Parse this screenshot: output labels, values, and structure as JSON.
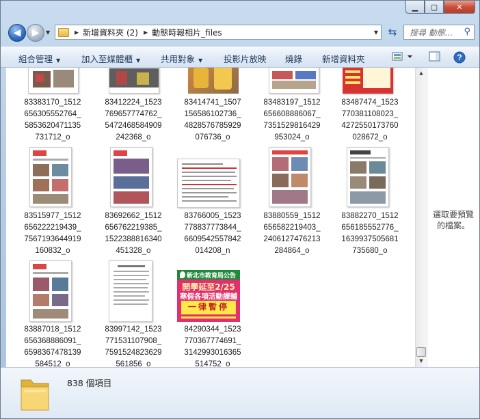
{
  "nav": {
    "breadcrumb": [
      "新增資料夾 (2)",
      "動態時報相片_files"
    ],
    "search_placeholder": "搜尋 動態..."
  },
  "toolbar": {
    "organize": "組合管理",
    "add_to_library": "加入至媒體櫃",
    "share_with": "共用對象",
    "slideshow": "投影片放映",
    "burn": "燒錄",
    "new_folder": "新增資料夾"
  },
  "files": [
    {
      "caption": [
        "83383170_1512",
        "656305552764_",
        "5853620471135",
        "731712_o"
      ]
    },
    {
      "caption": [
        "83412224_1523",
        "769657774762_",
        "5472468584909",
        "242368_o"
      ]
    },
    {
      "caption": [
        "83414741_1507",
        "156586102736_",
        "4828576785929",
        "076736_o"
      ]
    },
    {
      "caption": [
        "83483197_1512",
        "656608886067_",
        "7351529816429",
        "953024_o"
      ]
    },
    {
      "caption": [
        "83487474_1523",
        "770381108023_",
        "4272550173760",
        "028672_o"
      ]
    },
    {
      "caption": [
        "83515977_1512",
        "656222219439_",
        "7567193644919",
        "160832_o"
      ]
    },
    {
      "caption": [
        "83692662_1512",
        "656762219385_",
        "1522388816340",
        "451328_o"
      ]
    },
    {
      "caption": [
        "83766005_1523",
        "778837773844_",
        "6609542557842",
        "014208_n"
      ]
    },
    {
      "caption": [
        "83880559_1512",
        "656582219403_",
        "2406127476213",
        "284864_o"
      ]
    },
    {
      "caption": [
        "83882270_1512",
        "656185552776_",
        "1639937505681",
        "735680_o"
      ]
    },
    {
      "caption": [
        "83887018_1512",
        "656368886091_",
        "6598367478139",
        "584512_o"
      ]
    },
    {
      "caption": [
        "83997142_1523",
        "771531107908_",
        "7591524823629",
        "561856_o"
      ]
    },
    {
      "caption": [
        "84290344_1523",
        "770367774691_",
        "3142993016365",
        "514752_o"
      ]
    }
  ],
  "poster": {
    "header": "新北市教育局公告",
    "line1": "開學延至2/25",
    "line2": "寒假各項活動課輔",
    "line3": "一律暫停"
  },
  "preview_pane": {
    "message": [
      "選取要預覽",
      "的檔案。"
    ]
  },
  "details": {
    "item_count": "838 個項目"
  },
  "colors": {
    "poster_pink": "#e0306e",
    "poster_yellow": "#ffe94a",
    "poster_red": "#c3201e"
  }
}
